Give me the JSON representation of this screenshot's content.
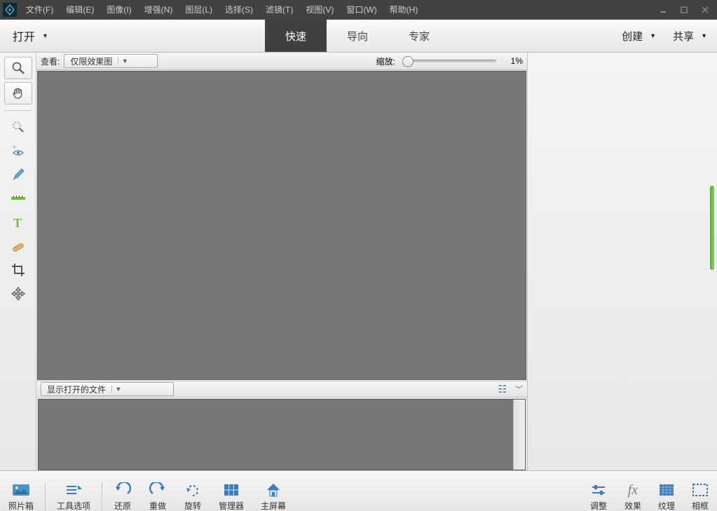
{
  "menubar": {
    "items": [
      "文件(F)",
      "编辑(E)",
      "图像(I)",
      "增强(N)",
      "图层(L)",
      "选择(S)",
      "滤镜(T)",
      "视图(V)",
      "窗口(W)",
      "帮助(H)"
    ]
  },
  "modebar": {
    "open": "打开",
    "tabs": [
      "快速",
      "导向",
      "专家"
    ],
    "active": 0,
    "create": "创建",
    "share": "共享"
  },
  "viewbar": {
    "label": "查看:",
    "option": "仅限效果图",
    "zoom_label": "缩放:",
    "zoom_value": "1%"
  },
  "filebar": {
    "option": "显示打开的文件"
  },
  "tools": {
    "names": [
      "zoom-tool",
      "hand-tool",
      "quick-select-tool",
      "eye-tool",
      "brush-tool",
      "straighten-tool",
      "text-tool",
      "heal-tool",
      "crop-tool",
      "move-tool"
    ]
  },
  "bottombar": {
    "left": [
      {
        "name": "photo-bin",
        "label": "照片箱"
      },
      {
        "name": "tool-options",
        "label": "工具选项"
      },
      {
        "name": "undo",
        "label": "还原"
      },
      {
        "name": "redo",
        "label": "重做"
      },
      {
        "name": "rotate",
        "label": "旋转"
      },
      {
        "name": "organizer",
        "label": "管理器"
      },
      {
        "name": "home",
        "label": "主屏幕"
      }
    ],
    "right": [
      {
        "name": "adjust",
        "label": "调整"
      },
      {
        "name": "effects",
        "label": "效果"
      },
      {
        "name": "textures",
        "label": "纹理"
      },
      {
        "name": "frames",
        "label": "相框"
      }
    ]
  }
}
